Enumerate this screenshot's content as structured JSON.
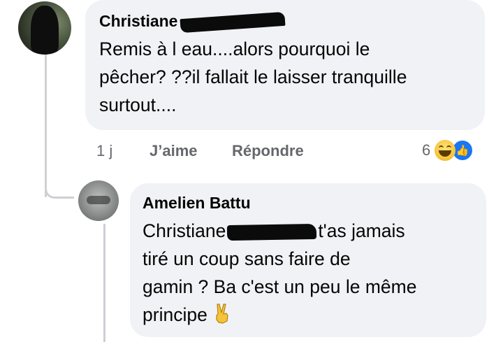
{
  "comment": {
    "author": "Christiane",
    "lines": [
      "Remis à  l eau....alors pourquoi  le",
      "pêcher? ??il fallait le laisser tranquille",
      "surtout...."
    ],
    "time": "1 j",
    "like_label": "J’aime",
    "reply_label": "Répondre",
    "reaction_count": "6",
    "reactions": [
      "haha-icon",
      "like-icon"
    ]
  },
  "reply": {
    "author": "Amelien Battu",
    "mention": "Christiane",
    "line1_after_mention": "t'as jamais",
    "lines": [
      "tiré un coup sans faire de",
      "gamin ? Ba c'est un peu le même",
      "principe"
    ],
    "emoji": "victory-hand-icon"
  },
  "colors": {
    "bubble": "#f0f2f5",
    "meta_text": "#65676b",
    "like_blue": "#1877f2",
    "thread_line": "#ced0d4"
  }
}
